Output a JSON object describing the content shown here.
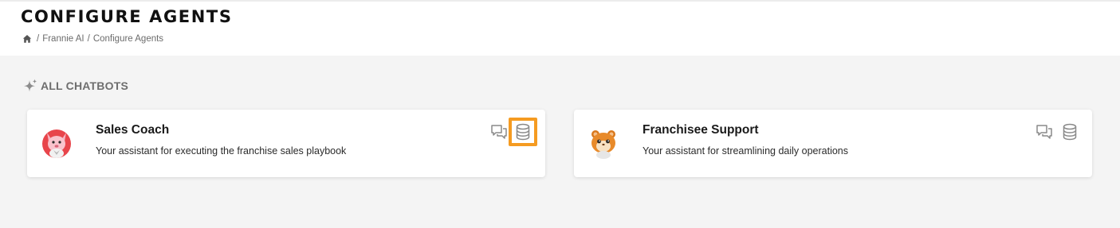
{
  "header": {
    "title": "CONFIGURE AGENTS",
    "breadcrumb": [
      {
        "label": "/",
        "type": "separator"
      },
      {
        "label": "Frannie AI",
        "type": "link"
      },
      {
        "label": "/",
        "type": "separator"
      },
      {
        "label": "Configure Agents",
        "type": "current"
      }
    ]
  },
  "section": {
    "title": "ALL CHATBOTS",
    "icon": "sparkle-icon"
  },
  "agents": [
    {
      "name": "Sales Coach",
      "description": "Your assistant for executing the franchise sales playbook",
      "avatar": "pink-fox-avatar",
      "actions": [
        "chat-icon",
        "database-icon"
      ],
      "highlighted_action": "database-icon"
    },
    {
      "name": "Franchisee Support",
      "description": "Your assistant for streamlining daily operations",
      "avatar": "orange-hamster-avatar",
      "actions": [
        "chat-icon",
        "database-icon"
      ]
    }
  ],
  "colors": {
    "background": "#f4f4f4",
    "card": "#ffffff",
    "highlight": "#f59b21",
    "icon": "#8a8a8a"
  }
}
